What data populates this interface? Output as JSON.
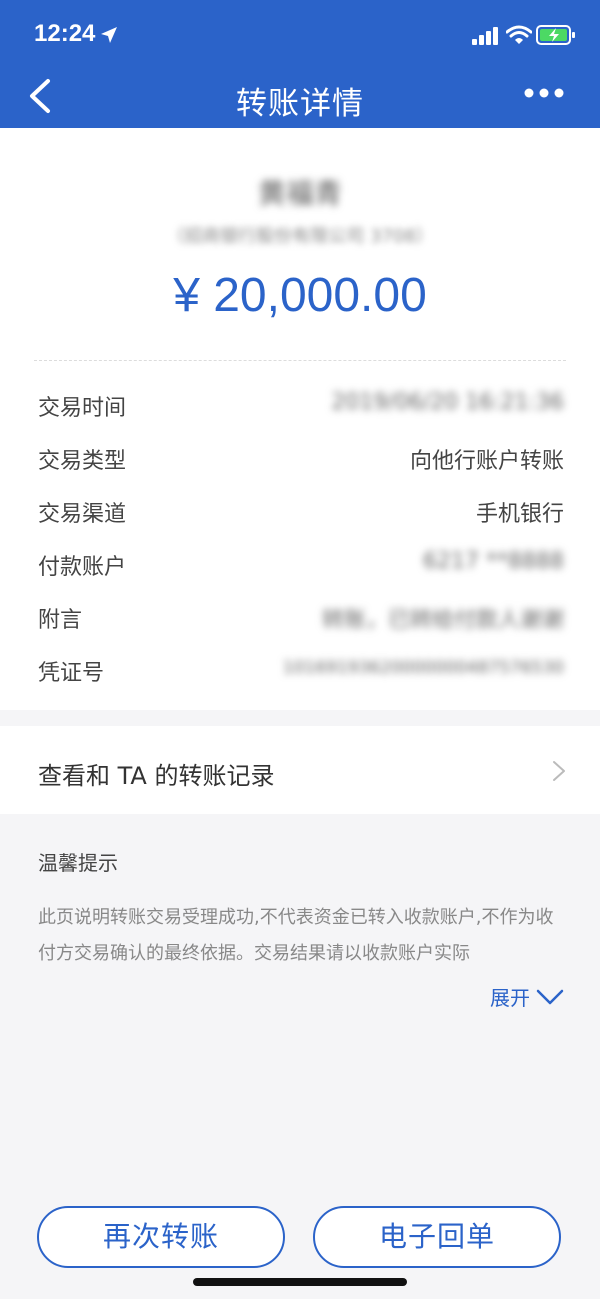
{
  "status_bar": {
    "time": "12:24"
  },
  "nav": {
    "title": "转账详情"
  },
  "payee": {
    "name": "黄福青",
    "bank": "（招商银行股份有限公司 3708）"
  },
  "amount": "¥ 20,000.00",
  "details": [
    {
      "label": "交易时间",
      "value": "2019/06/20 16:21:36"
    },
    {
      "label": "交易类型",
      "value": "向他行账户转账"
    },
    {
      "label": "交易渠道",
      "value": "手机银行"
    },
    {
      "label": "付款账户",
      "value": "6217 **8888"
    },
    {
      "label": "附言",
      "value": "转账，已转给付款人谢谢"
    },
    {
      "label": "凭证号",
      "value": "10169193620000000487576530"
    }
  ],
  "record": {
    "label": "查看和 TA 的转账记录"
  },
  "tips": {
    "title": "温馨提示",
    "body": "此页说明转账交易受理成功,不代表资金已转入收款账户,不作为收付方交易确认的最终依据。交易结果请以收款账户实际",
    "expand_label": "展开"
  },
  "buttons": {
    "transfer_again": "再次转账",
    "receipt": "电子回单"
  },
  "colors": {
    "brand": "#2b63c9"
  }
}
